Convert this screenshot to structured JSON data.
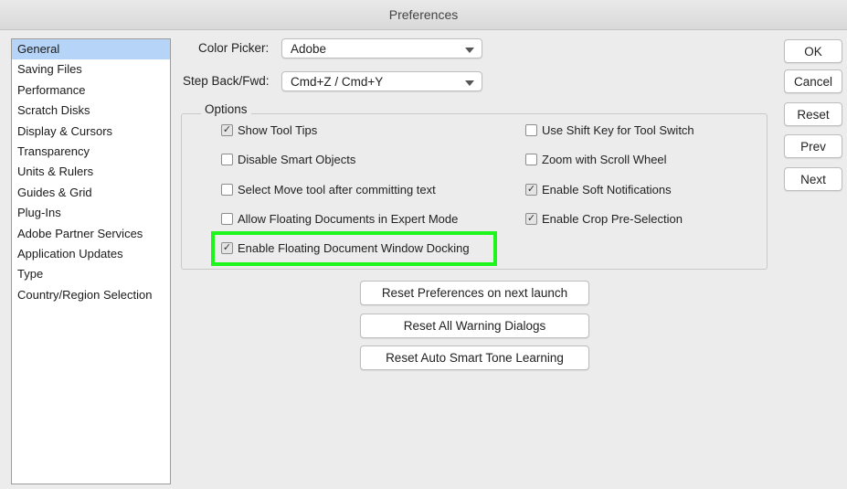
{
  "window": {
    "title": "Preferences"
  },
  "sidebar": {
    "items": [
      {
        "label": "General",
        "selected": true
      },
      {
        "label": "Saving Files"
      },
      {
        "label": "Performance"
      },
      {
        "label": "Scratch Disks"
      },
      {
        "label": "Display & Cursors"
      },
      {
        "label": "Transparency"
      },
      {
        "label": "Units & Rulers"
      },
      {
        "label": "Guides & Grid"
      },
      {
        "label": "Plug-Ins"
      },
      {
        "label": "Adobe Partner Services"
      },
      {
        "label": "Application Updates"
      },
      {
        "label": "Type"
      },
      {
        "label": "Country/Region Selection"
      }
    ]
  },
  "general": {
    "color_picker": {
      "label": "Color Picker:",
      "value": "Adobe"
    },
    "step_back": {
      "label": "Step Back/Fwd:",
      "value": "Cmd+Z / Cmd+Y"
    }
  },
  "options": {
    "legend": "Options",
    "left": [
      {
        "label": "Show Tool Tips",
        "checked": true
      },
      {
        "label": "Disable Smart Objects",
        "checked": false
      },
      {
        "label": "Select Move tool after committing text",
        "checked": false
      },
      {
        "label": "Allow Floating Documents in Expert Mode",
        "checked": false
      },
      {
        "label": "Enable Floating Document Window Docking",
        "checked": true
      }
    ],
    "right": [
      {
        "label": "Use Shift Key for Tool Switch",
        "checked": false
      },
      {
        "label": "Zoom with Scroll Wheel",
        "checked": false
      },
      {
        "label": "Enable Soft Notifications",
        "checked": true
      },
      {
        "label": "Enable Crop Pre-Selection",
        "checked": true
      }
    ]
  },
  "reset_buttons": {
    "prefs": "Reset Preferences on next launch",
    "warnings": "Reset All Warning Dialogs",
    "smart_tone": "Reset Auto Smart Tone Learning"
  },
  "dialog_buttons": {
    "ok": "OK",
    "cancel": "Cancel",
    "reset": "Reset",
    "prev": "Prev",
    "next": "Next"
  },
  "colors": {
    "selection": "#b6d4f8",
    "highlight": "#1df51d"
  }
}
